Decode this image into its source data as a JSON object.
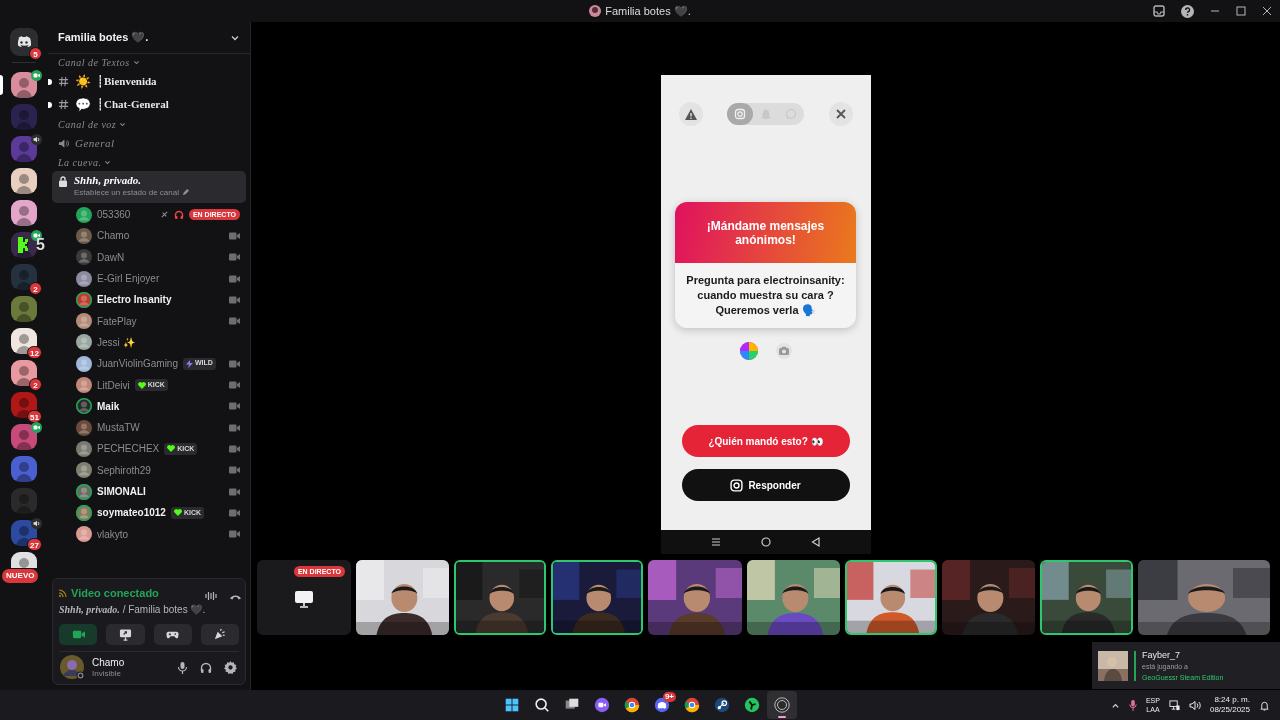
{
  "window": {
    "title": "Familia botes 🖤."
  },
  "servers": [
    {
      "kind": "home",
      "badge": "5",
      "selected": false
    },
    {
      "kind": "avatar",
      "selected": true,
      "in_video": true
    },
    {
      "kind": "avatar",
      "selected": false
    },
    {
      "kind": "avatar",
      "selected": false,
      "in_voice": true
    },
    {
      "kind": "avatar",
      "selected": false
    },
    {
      "kind": "avatar",
      "selected": false
    },
    {
      "kind": "avatar",
      "selected": false,
      "in_video": true
    },
    {
      "kind": "avatar",
      "selected": false,
      "badge": "2"
    },
    {
      "kind": "avatar",
      "selected": false
    },
    {
      "kind": "avatar",
      "selected": false,
      "badge": "12"
    },
    {
      "kind": "avatar",
      "selected": false,
      "badge": "2"
    },
    {
      "kind": "avatar",
      "selected": false,
      "badge": "51"
    },
    {
      "kind": "avatar",
      "selected": false,
      "in_video": true
    },
    {
      "kind": "avatar",
      "selected": false
    },
    {
      "kind": "avatar",
      "selected": false
    },
    {
      "kind": "avatar",
      "selected": false,
      "in_voice": true,
      "badge": "27"
    },
    {
      "kind": "avatar",
      "selected": false,
      "badge": "NUEVO"
    }
  ],
  "overlay_count": "5",
  "sidebar": {
    "server_name": "Familia botes 🖤.",
    "text_category": "Canal de Textos",
    "text_channels": [
      {
        "emoji": "☀️",
        "name": "┊Bienvenida",
        "unread": true
      },
      {
        "emoji": "💬",
        "name": "┊Chat-General",
        "unread": true
      }
    ],
    "voice_category": "Canal de voz",
    "voice_channels": [
      {
        "name": "General"
      }
    ],
    "cave_category": "La cueva.",
    "active_channel": {
      "name": "Shhh, privado.",
      "status_placeholder": "Establece un estado de canal"
    },
    "members": [
      {
        "name": "053360",
        "speaking": false,
        "video": false,
        "live": "EN DIRECTO"
      },
      {
        "name": "Chamo",
        "speaking": false,
        "video": true
      },
      {
        "name": "DawN",
        "speaking": false,
        "video": true
      },
      {
        "name": "E-Girl Enjoyer",
        "speaking": false,
        "video": true
      },
      {
        "name": "Electro Insanity",
        "speaking": true,
        "video": true
      },
      {
        "name": "FatePlay",
        "speaking": false,
        "video": true
      },
      {
        "name": "Jessi ✨",
        "speaking": false,
        "video": false
      },
      {
        "name": "JuanViolinGaming",
        "speaking": false,
        "video": true,
        "tag": {
          "kind": "wild",
          "label": "WILD"
        }
      },
      {
        "name": "LitDeivi",
        "speaking": false,
        "video": true,
        "tag": {
          "kind": "kick",
          "label": "KICK"
        }
      },
      {
        "name": "Maik",
        "speaking": true,
        "video": true
      },
      {
        "name": "MustaTW",
        "speaking": false,
        "video": true
      },
      {
        "name": "PECHECHEX",
        "speaking": false,
        "video": true,
        "tag": {
          "kind": "kick",
          "label": "KICK"
        }
      },
      {
        "name": "Sephiroth29",
        "speaking": false,
        "video": true
      },
      {
        "name": "SIMONALI",
        "speaking": true,
        "video": true
      },
      {
        "name": "soymateo1012",
        "speaking": true,
        "video": true,
        "tag": {
          "kind": "kick",
          "label": "KICK"
        }
      },
      {
        "name": "vlakyto",
        "speaking": false,
        "video": true
      }
    ]
  },
  "voice_panel": {
    "status": "Video conectado",
    "location": "**Shhh, privado.** / Familia botes 🖤.",
    "buttons": [
      {
        "kind": "camera",
        "selected": true
      },
      {
        "kind": "screen",
        "selected": false
      },
      {
        "kind": "activity",
        "selected": false
      },
      {
        "kind": "soundboard",
        "selected": false
      }
    ]
  },
  "user_panel": {
    "name": "Chamo",
    "status": "Invisible"
  },
  "stream": {
    "share_tabs": [
      {
        "kind": "instagram",
        "selected": true
      },
      {
        "kind": "snapchat",
        "selected": false
      },
      {
        "kind": "whatsapp",
        "selected": false
      }
    ],
    "card_title": "¡Mándame mensajes anónimos!",
    "question": "Pregunta para electroinsanity: cuando muestra su cara ? Queremos verla 🗣️",
    "who_button": "¿Quién mandó esto? 👀",
    "reply_button": "Responder"
  },
  "tiles": [
    {
      "kind": "screen",
      "speaking": false,
      "live": "EN DIRECTO"
    },
    {
      "kind": "camera",
      "speaking": false
    },
    {
      "kind": "camera",
      "speaking": true
    },
    {
      "kind": "camera",
      "speaking": true
    },
    {
      "kind": "camera",
      "speaking": false
    },
    {
      "kind": "camera",
      "speaking": false
    },
    {
      "kind": "camera",
      "speaking": true
    },
    {
      "kind": "camera",
      "speaking": false
    },
    {
      "kind": "camera",
      "speaking": true
    },
    {
      "kind": "camera",
      "speaking": false
    }
  ],
  "toast": {
    "name": "Fayber_7",
    "line": "está jugando a",
    "game": "GeoGuessr Steam Edition"
  },
  "taskbar": {
    "apps": [
      {
        "kind": "start",
        "active": false
      },
      {
        "kind": "search",
        "active": false
      },
      {
        "kind": "taskview",
        "active": false
      },
      {
        "kind": "meet",
        "active": false
      },
      {
        "kind": "chrome",
        "active": false
      },
      {
        "kind": "discord",
        "active": false,
        "badge": "9+"
      },
      {
        "kind": "chrome",
        "active": false
      },
      {
        "kind": "steam",
        "active": false
      },
      {
        "kind": "spinner",
        "active": false
      },
      {
        "kind": "obs",
        "active": true
      }
    ],
    "language": "ESP",
    "layout": "LAA",
    "time": "8:24 p. m.",
    "date": "08/25/2025"
  }
}
